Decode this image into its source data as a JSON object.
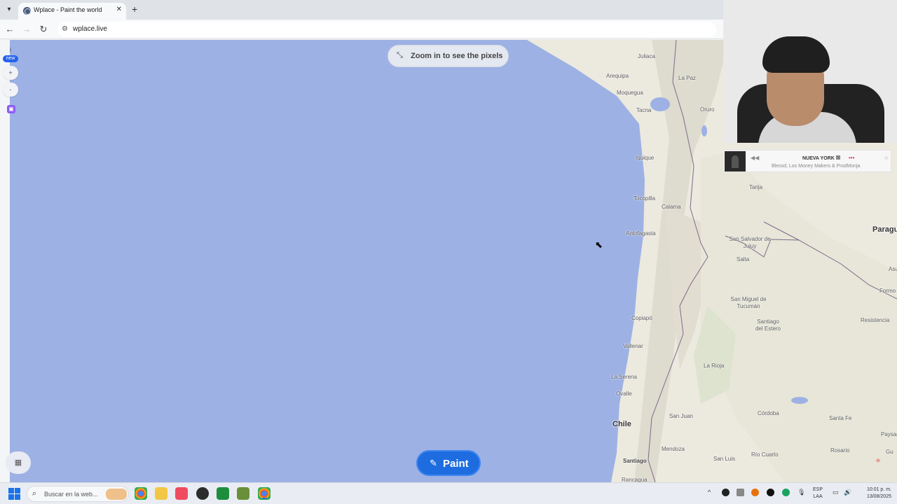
{
  "browser": {
    "tab_title": "Wplace - Paint the world",
    "url": "wplace.live",
    "menu_icon": "chevron-down-icon",
    "new_tab_label": "+",
    "close_tab_label": "✕"
  },
  "map": {
    "zoom_hint": "Zoom in to see the pixels",
    "paint_label": "Paint",
    "ocean_color": "#9db1e4",
    "land_color": "#ece9df",
    "new_badge": "new",
    "info_label": "i",
    "zoom_in_label": "+",
    "zoom_out_label": "-",
    "cities": [
      {
        "name": "Juliaca"
      },
      {
        "name": "La Paz"
      },
      {
        "name": "Arequipa"
      },
      {
        "name": "Moquegua"
      },
      {
        "name": "Tacna"
      },
      {
        "name": "Oruro"
      },
      {
        "name": "Iquique"
      },
      {
        "name": "Tarija"
      },
      {
        "name": "Tocopilla"
      },
      {
        "name": "Calama"
      },
      {
        "name": "Antofagasta"
      },
      {
        "name": "San Salvador de Jujuy"
      },
      {
        "name": "Salta"
      },
      {
        "name": "San Miguel de Tucumán"
      },
      {
        "name": "Santiago del Estero"
      },
      {
        "name": "Copiapó"
      },
      {
        "name": "Vallenar"
      },
      {
        "name": "La Rioja"
      },
      {
        "name": "La Serena"
      },
      {
        "name": "Ovalle"
      },
      {
        "name": "Córdoba"
      },
      {
        "name": "San Juan"
      },
      {
        "name": "Santa Fe"
      },
      {
        "name": "Mendoza"
      },
      {
        "name": "Río Cuarto"
      },
      {
        "name": "San Luis"
      },
      {
        "name": "Rosario"
      },
      {
        "name": "Santiago"
      },
      {
        "name": "Rancagua"
      },
      {
        "name": "Resistencia"
      },
      {
        "name": "Formo"
      },
      {
        "name": "Paysar"
      },
      {
        "name": "Gu"
      },
      {
        "name": "Asu"
      }
    ],
    "countries": [
      {
        "name": "Chile"
      },
      {
        "name": "Paragu"
      }
    ]
  },
  "music": {
    "title": "NUEVA YORK",
    "artist": "Blessd, Los Money Makers & ProdMonja",
    "more": "•••",
    "star": "☆",
    "play_icon": "◀◀"
  },
  "taskbar": {
    "search_placeholder": "Buscar en la web...",
    "lang_line1": "ESP",
    "lang_line2": "LAA",
    "time": "10:01 p. m.",
    "date": "13/08/2025"
  }
}
